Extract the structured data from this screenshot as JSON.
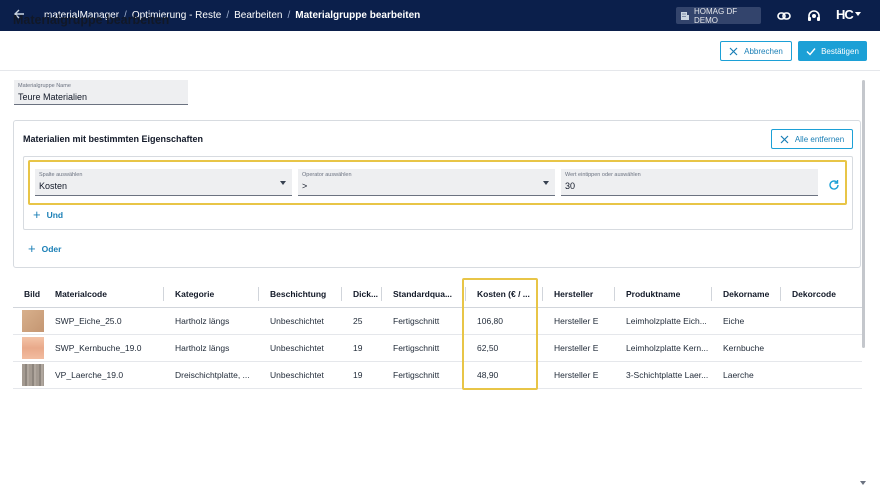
{
  "topbar": {
    "breadcrumbs": [
      "materialManager",
      "Optimierung - Reste",
      "Bearbeiten"
    ],
    "current": "Materialgruppe bearbeiten",
    "tenant": "HOMAG DF DEMO",
    "logo": "HC",
    "icons": [
      "back-arrow-icon",
      "building-icon",
      "link-icon",
      "headset-icon"
    ]
  },
  "header": {
    "title": "Materialgruppe bearbeiten",
    "cancel_label": "Abbrechen",
    "confirm_label": "Bestätigen"
  },
  "name_field": {
    "label": "Materialgruppe Name",
    "value": "Teure Materialien"
  },
  "filter_card": {
    "title": "Materialien mit bestimmten Eigenschaften",
    "remove_all_label": "Alle entfernen",
    "column_select": {
      "label": "Spalte auswählen",
      "value": "Kosten"
    },
    "operator_select": {
      "label": "Operator auswählen",
      "value": ">"
    },
    "value_input": {
      "label": "Wert eintippen oder auswählen",
      "value": "30"
    },
    "and_label": "Und",
    "or_label": "Oder"
  },
  "table": {
    "columns": [
      "Bild",
      "Materialcode",
      "Kategorie",
      "Beschichtung",
      "Dick...",
      "Standardqua...",
      "Kosten (€ / ...",
      "Hersteller",
      "Produktname",
      "Dekorname",
      "Dekorcode"
    ],
    "rows": [
      {
        "swatch": "#cfa583",
        "code": "SWP_Eiche_25.0",
        "kategorie": "Hartholz längs",
        "beschichtung": "Unbeschichtet",
        "dicke": "25",
        "standard": "Fertigschnitt",
        "kosten": "106,80",
        "hersteller": "Hersteller E",
        "produkt": "Leimholzplatte Eich...",
        "dekor": "Eiche",
        "dekorcode": ""
      },
      {
        "swatch": "#efb79a",
        "code": "SWP_Kernbuche_19.0",
        "kategorie": "Hartholz längs",
        "beschichtung": "Unbeschichtet",
        "dicke": "19",
        "standard": "Fertigschnitt",
        "kosten": "62,50",
        "hersteller": "Hersteller E",
        "produkt": "Leimholzplatte Kern...",
        "dekor": "Kernbuche",
        "dekorcode": ""
      },
      {
        "swatch": "#9c948c",
        "code": "VP_Laerche_19.0",
        "kategorie": "Dreischichtplatte, ...",
        "beschichtung": "Unbeschichtet",
        "dicke": "19",
        "standard": "Fertigschnitt",
        "kosten": "48,90",
        "hersteller": "Hersteller E",
        "produkt": "3-Schichtplatte Laer...",
        "dekor": "Laerche",
        "dekorcode": ""
      }
    ]
  },
  "colors": {
    "topbar": "#0b1f4b",
    "accent": "#1ca0d6",
    "highlight": "#e8c547"
  }
}
